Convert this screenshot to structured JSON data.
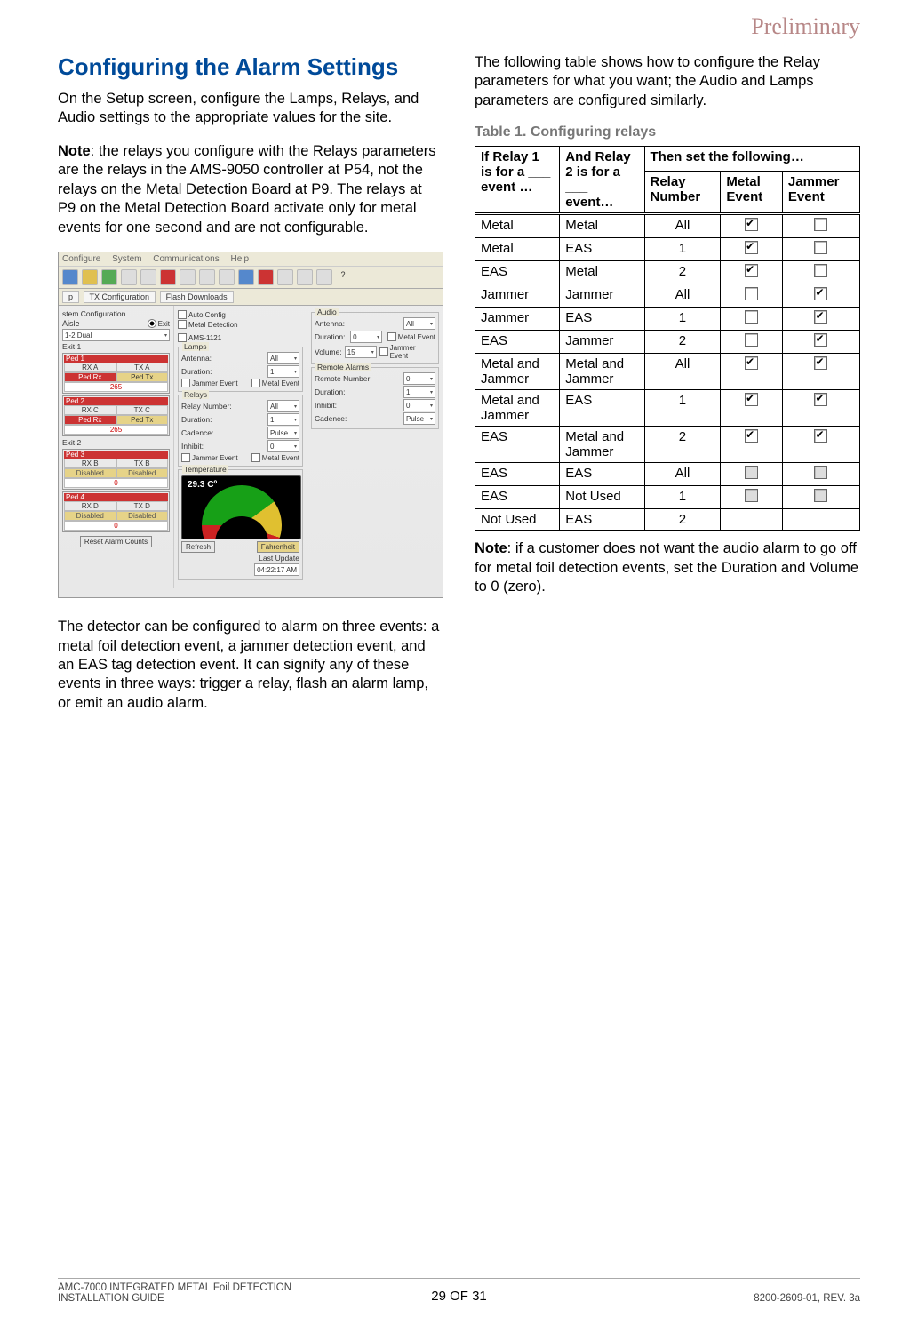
{
  "watermark": "Preliminary",
  "left": {
    "heading": "Configuring the Alarm Settings",
    "para1": "On the Setup screen, configure the Lamps, Relays, and Audio settings to the appropriate values for the site.",
    "note_label": "Note",
    "note_body": ": the relays you configure with the Relays parameters are the relays in the AMS-9050 controller at P54, not the relays on the Metal Detection Board at P9. The relays at P9 on the Metal Detection Board activate only for metal events for one second and are not configurable.",
    "para2": "The detector can be configured to alarm on three events: a metal foil detection event, a jammer detection event, and an EAS tag detection event. It can signify any of these events in three ways: trigger a relay, flash an alarm lamp, or emit an audio alarm."
  },
  "right": {
    "intro": "The following table shows how to configure the Relay parameters for what you want; the Audio and Lamps parameters are configured similarly.",
    "table_caption": "Table 1. Configuring relays",
    "header": {
      "c1": "If Relay 1 is for a ___ event …",
      "c2": "And Relay 2 is for a ___ event…",
      "c3": "Then set the following…",
      "s1": "Relay Number",
      "s2": "Metal Event",
      "s3": "Jammer Event"
    },
    "rows": [
      {
        "r1": "Metal",
        "r2": "Metal",
        "num": "All",
        "metal": "checked",
        "jam": "unchecked"
      },
      {
        "r1": "Metal",
        "r2": "EAS",
        "num": "1",
        "metal": "checked",
        "jam": "unchecked"
      },
      {
        "r1": "EAS",
        "r2": "Metal",
        "num": "2",
        "metal": "checked",
        "jam": "unchecked"
      },
      {
        "r1": "Jammer",
        "r2": "Jammer",
        "num": "All",
        "metal": "unchecked",
        "jam": "checked"
      },
      {
        "r1": "Jammer",
        "r2": "EAS",
        "num": "1",
        "metal": "unchecked",
        "jam": "checked"
      },
      {
        "r1": "EAS",
        "r2": "Jammer",
        "num": "2",
        "metal": "unchecked",
        "jam": "checked"
      },
      {
        "r1": "Metal and Jammer",
        "r2": "Metal and Jammer",
        "num": "All",
        "metal": "checked",
        "jam": "checked"
      },
      {
        "r1": "Metal and Jammer",
        "r2": "EAS",
        "num": "1",
        "metal": "checked",
        "jam": "checked"
      },
      {
        "r1": "EAS",
        "r2": "Metal and Jammer",
        "num": "2",
        "metal": "checked",
        "jam": "checked"
      },
      {
        "r1": "EAS",
        "r2": "EAS",
        "num": "All",
        "metal": "gray",
        "jam": "gray"
      },
      {
        "r1": "EAS",
        "r2": "Not Used",
        "num": "1",
        "metal": "gray",
        "jam": "gray"
      },
      {
        "r1": "Not Used",
        "r2": "EAS",
        "num": "2",
        "metal": "blank",
        "jam": "blank"
      }
    ],
    "note_label": "Note",
    "note_body": ": if a customer does not want the audio alarm to go off for metal foil detection events, set the Duration and Volume to 0 (zero)."
  },
  "screenshot": {
    "menubar": [
      "Configure",
      "System",
      "Communications",
      "Help"
    ],
    "tabs": [
      "p",
      "TX Configuration",
      "Flash Downloads"
    ],
    "sysconfig_label": "stem Configuration",
    "aisle_label": "Aisle",
    "aisle_exit": "Exit",
    "autoconfig": "Auto Config",
    "metaldet": "Metal Detection",
    "dropdown_12": "1-2 Dual",
    "exit1": "Exit 1",
    "exit2": "Exit 2",
    "ped": {
      "p1": "Ped 1",
      "p2": "Ped 2",
      "p3": "Ped 3",
      "p4": "Ped 4",
      "rxa": "RX A",
      "txa": "TX A",
      "rxc": "RX C",
      "txc": "TX C",
      "rxb": "RX B",
      "txb": "TX B",
      "rxd": "RX D",
      "txd": "TX D",
      "pedrx": "Ped Rx",
      "pedtx": "Ped Tx",
      "val265": "265",
      "val0": "0",
      "disabled": "Disabled"
    },
    "reset_btn": "Reset Alarm Counts",
    "ams1121": "AMS-1121",
    "lamps": {
      "title": "Lamps",
      "antenna": "Antenna:",
      "all": "All",
      "duration": "Duration:",
      "dval": "1",
      "je": "Jammer Event",
      "me": "Metal Event"
    },
    "relays": {
      "title": "Relays",
      "rn": "Relay Number:",
      "all": "All",
      "duration": "Duration:",
      "dval": "1",
      "cadence": "Cadence:",
      "pulse": "Pulse",
      "inhibit": "Inhibit:",
      "ival": "0",
      "je": "Jammer Event",
      "me": "Metal Event"
    },
    "temp": {
      "title": "Temperature",
      "value": "29.3 Cº",
      "refresh": "Refresh",
      "fah": "Fahrenheit",
      "last": "Last Update",
      "time": "04:22:17 AM"
    },
    "audio": {
      "title": "Audio",
      "antenna": "Antenna:",
      "all": "All",
      "duration": "Duration:",
      "dval": "0",
      "volume": "Volume:",
      "vval": "15",
      "me": "Metal Event",
      "je": "Jammer Event"
    },
    "remote": {
      "title": "Remote Alarms",
      "rn": "Remote Number:",
      "rval": "0",
      "duration": "Duration:",
      "dval": "1",
      "inhibit": "Inhibit:",
      "ival": "0",
      "cadence": "Cadence:",
      "pulse": "Pulse"
    }
  },
  "footer": {
    "left1": "AMC-7000 INTEGRATED METAL Foil DETECTION",
    "left2": "INSTALLATION GUIDE",
    "center": "29 OF 31",
    "right": "8200-2609-01, REV. 3a"
  }
}
